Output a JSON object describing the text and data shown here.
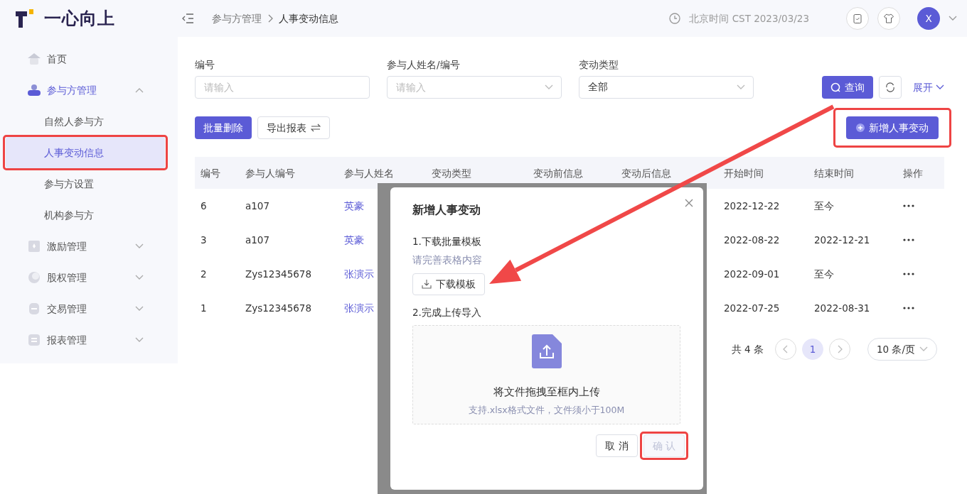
{
  "header": {
    "logo_text": "一心向上",
    "breadcrumb": [
      "参与方管理",
      "人事变动信息"
    ],
    "time_text": "北京时间 CST 2023/03/23",
    "avatar_letter": "X"
  },
  "sidebar": {
    "items": [
      {
        "label": "首页",
        "selected": false
      },
      {
        "label": "参与方管理",
        "selected": false,
        "expanded": true,
        "children": [
          {
            "label": "自然人参与方",
            "selected": false
          },
          {
            "label": "人事变动信息",
            "selected": true
          },
          {
            "label": "参与方设置",
            "selected": false
          },
          {
            "label": "机构参与方",
            "selected": false
          }
        ]
      },
      {
        "label": "激励管理",
        "selected": false,
        "expanded": false
      },
      {
        "label": "股权管理",
        "selected": false,
        "expanded": false
      },
      {
        "label": "交易管理",
        "selected": false,
        "expanded": false
      },
      {
        "label": "报表管理",
        "selected": false,
        "expanded": false
      }
    ]
  },
  "filters": [
    {
      "kind": "text",
      "label": "编号",
      "placeholder": "请输入"
    },
    {
      "kind": "select",
      "label": "参与人姓名/编号",
      "placeholder": "请输入"
    },
    {
      "kind": "select",
      "label": "变动类型",
      "value": "全部"
    }
  ],
  "query_button": "查询",
  "expand_link": "展开",
  "bulk_delete_button": "批量删除",
  "export_button": "导出报表",
  "add_button": "新增人事变动",
  "table": {
    "columns": [
      "编号",
      "参与人编号",
      "参与人姓名",
      "变动类型",
      "变动前信息",
      "变动后信息",
      "开始时间",
      "结束时间",
      "操作"
    ],
    "rows": [
      {
        "no": "6",
        "participant_no": "a107",
        "name": "英豪",
        "start": "2022-12-22",
        "end": "至今"
      },
      {
        "no": "3",
        "participant_no": "a107",
        "name": "英豪",
        "start": "2022-08-22",
        "end": "2022-12-21"
      },
      {
        "no": "2",
        "participant_no": "Zys12345678",
        "name": "张演示",
        "start": "2022-09-01",
        "end": "至今"
      },
      {
        "no": "1",
        "participant_no": "Zys12345678",
        "name": "张演示",
        "start": "2022-07-25",
        "end": "2022-08-31"
      }
    ]
  },
  "pagination": {
    "total": "共 4 条",
    "pages": [
      {
        "label": "1",
        "selected": true
      }
    ],
    "page_size": "10 条/页"
  },
  "modal": {
    "title": "新增人事变动",
    "step1": "1.下载批量模板",
    "hint": "请完善表格内容",
    "download_button": "下载模板",
    "step2": "2.完成上传导入",
    "drop_text": "将文件拖拽至框内上传",
    "drop_hint": "支持.xlsx格式文件，文件须小于100M",
    "cancel_button": "取 消",
    "confirm_button": "确 认",
    "confirm_disabled": true
  }
}
